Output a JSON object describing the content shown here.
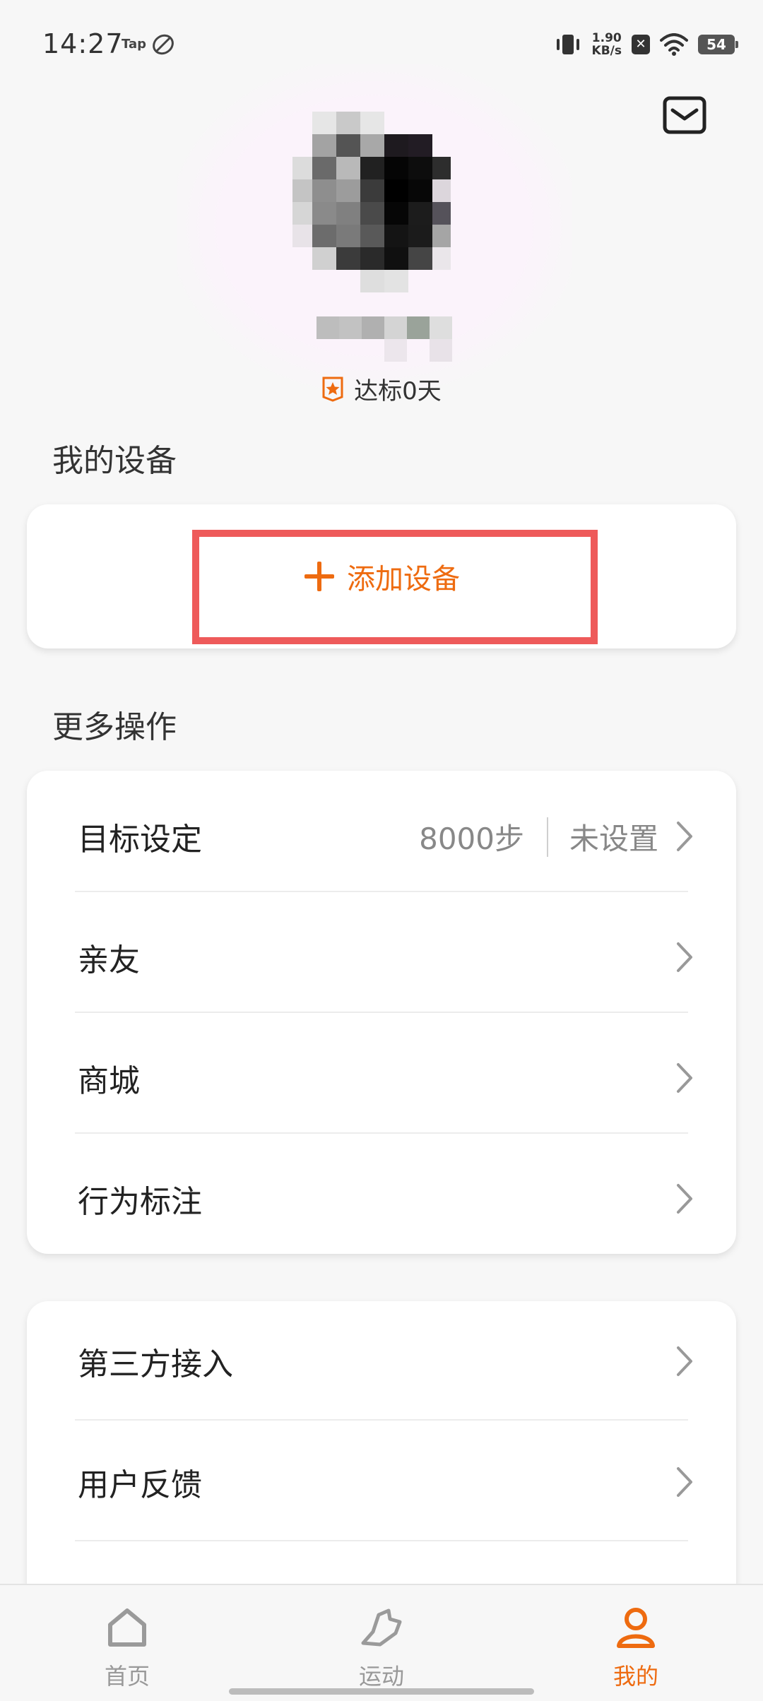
{
  "status_bar": {
    "time": "14:27",
    "tap_label": "Tap",
    "net_speed_value": "1.90",
    "net_speed_unit": "KB/s",
    "battery": "54"
  },
  "header": {
    "mail_icon": "mail-icon"
  },
  "profile": {
    "goal_days_label": "达标0天",
    "goal_icon": "badge-star-icon"
  },
  "devices": {
    "section_title": "我的设备",
    "add_device_label": "添加设备",
    "add_icon": "plus-icon",
    "highlight_color": "#ee5a5a"
  },
  "more_actions": {
    "section_title": "更多操作",
    "items": [
      {
        "label": "目标设定",
        "value": "8000步",
        "value2": "未设置"
      },
      {
        "label": "亲友"
      },
      {
        "label": "商城"
      },
      {
        "label": "行为标注"
      }
    ]
  },
  "other_actions": {
    "items": [
      {
        "label": "第三方接入"
      },
      {
        "label": "用户反馈"
      }
    ]
  },
  "bottom_nav": {
    "items": [
      {
        "label": "首页",
        "icon": "home-icon",
        "active": false
      },
      {
        "label": "运动",
        "icon": "shoe-icon",
        "active": false
      },
      {
        "label": "我的",
        "icon": "person-icon",
        "active": true
      }
    ]
  },
  "colors": {
    "accent": "#ee6b10",
    "background": "#f7f7f7",
    "card": "#ffffff",
    "text_secondary": "#888888"
  }
}
